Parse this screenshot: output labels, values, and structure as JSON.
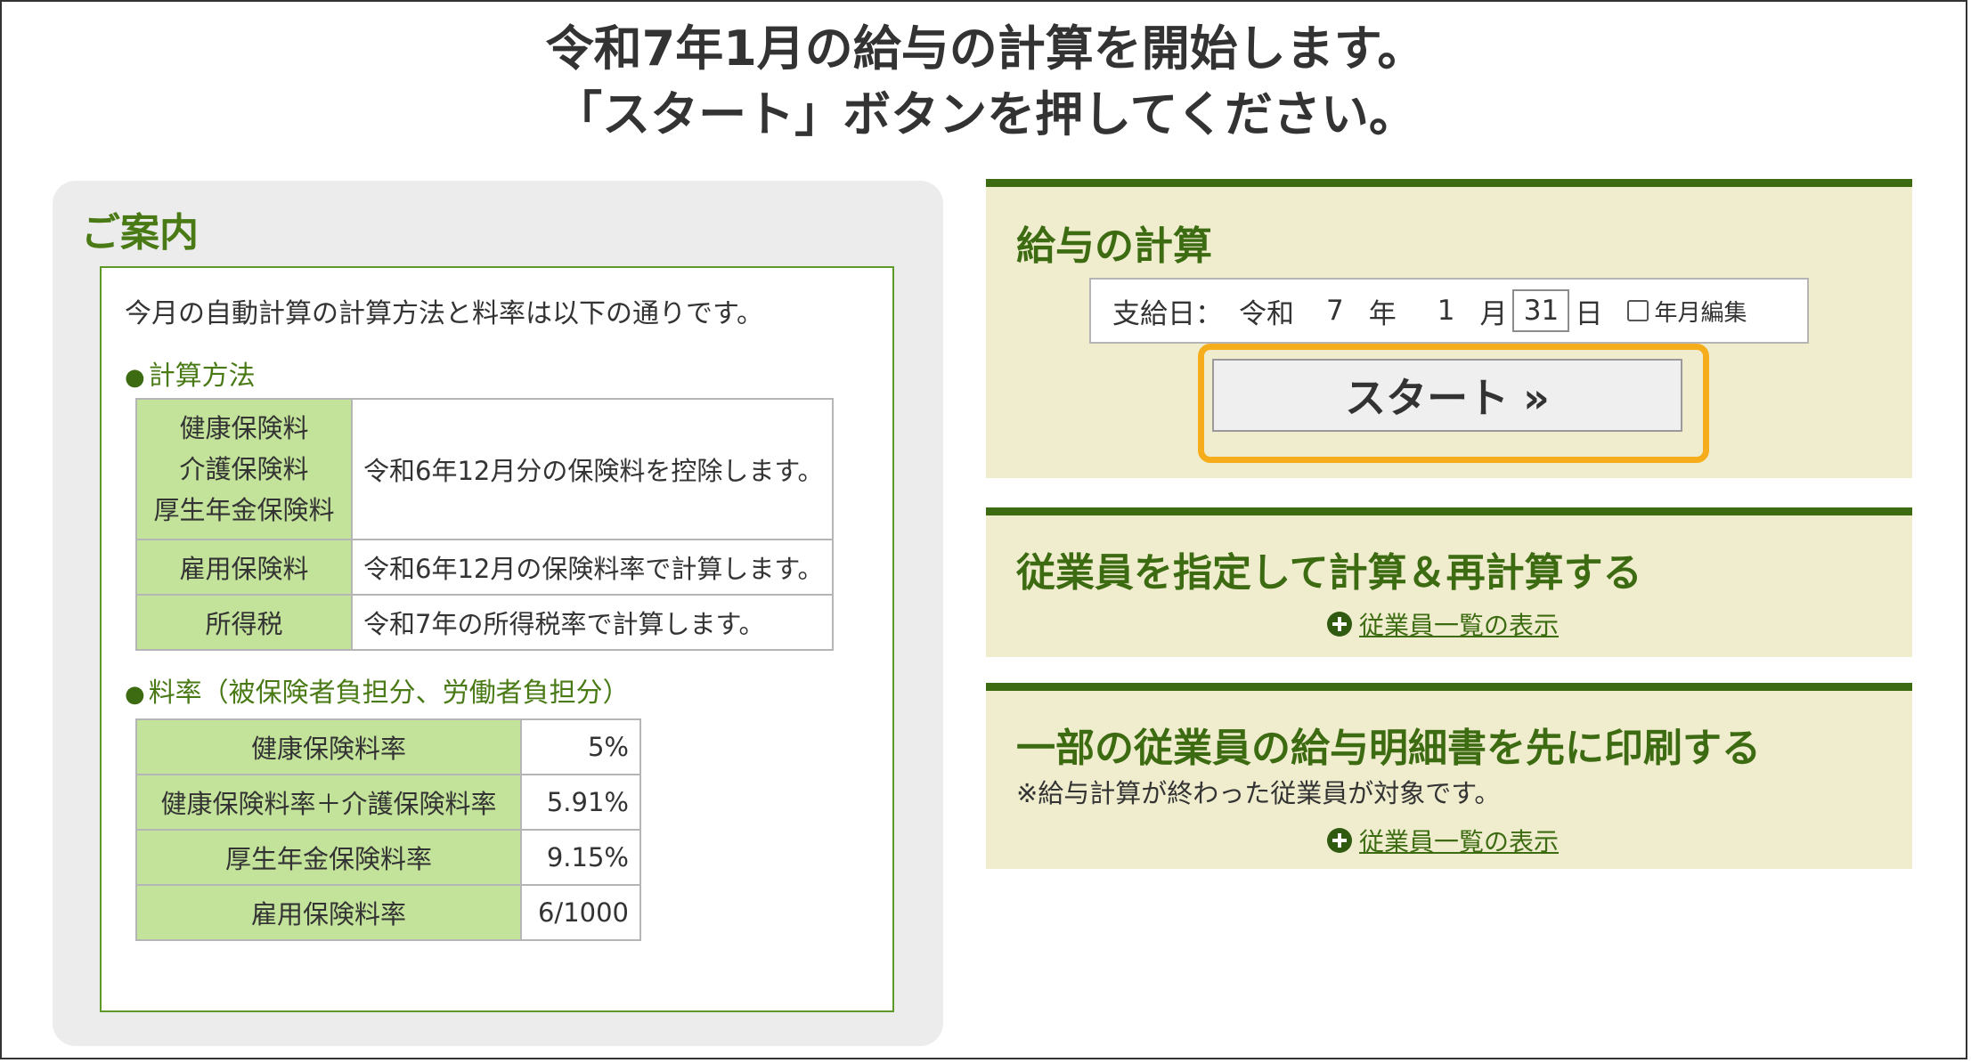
{
  "headline": {
    "line1": "令和7年1月の給与の計算を開始します。",
    "line2": "「スタート」ボタンを押してください。"
  },
  "guide": {
    "title": "ご案内",
    "intro": "今月の自動計算の計算方法と料率は以下の通りです。",
    "method_heading": "計算方法",
    "method_rows": [
      {
        "labels": [
          "健康保険料",
          "介護保険料",
          "厚生年金保険料"
        ],
        "value": "令和6年12月分の保険料を控除します。"
      },
      {
        "labels": [
          "雇用保険料"
        ],
        "value": "令和6年12月の保険料率で計算します。"
      },
      {
        "labels": [
          "所得税"
        ],
        "value": "令和7年の所得税率で計算します。"
      }
    ],
    "rate_heading": "料率（被保険者負担分、労働者負担分）",
    "rate_rows": [
      {
        "label": "健康保険料率",
        "value": "5%"
      },
      {
        "label": "健康保険料率＋介護保険料率",
        "value": "5.91%"
      },
      {
        "label": "厚生年金保険料率",
        "value": "9.15%"
      },
      {
        "label": "雇用保険料率",
        "value": "6/1000"
      }
    ]
  },
  "payroll": {
    "title": "給与の計算",
    "date_label": "支給日：",
    "era": "令和",
    "year": "7",
    "year_unit": "年",
    "month": "1",
    "month_unit": "月",
    "day": "31",
    "day_unit": "日",
    "edit_label": "年月編集",
    "start_label": "スタート »"
  },
  "recalc": {
    "title": "従業員を指定して計算＆再計算する",
    "link": "従業員一覧の表示"
  },
  "print": {
    "title": "一部の従業員の給与明細書を先に印刷する",
    "note": "※給与計算が終わった従業員が対象です。",
    "link": "従業員一覧の表示"
  },
  "colors": {
    "accent_green": "#3d6b12",
    "label_green": "#c3e29a",
    "panel_bg": "#efedce",
    "highlight": "#f5ad1b"
  }
}
